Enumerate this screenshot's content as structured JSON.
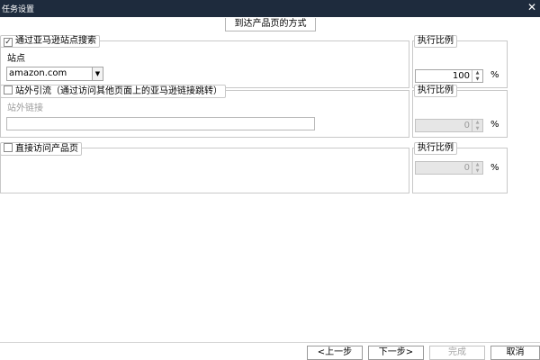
{
  "window": {
    "title": "任务设置"
  },
  "header": {
    "label": "到达产品页的方式"
  },
  "sections": [
    {
      "legend": "通过亚马逊站点搜索",
      "checked": true,
      "site_label": "站点",
      "site_value": "amazon.com",
      "ratio_label": "执行比例",
      "ratio_value": "100",
      "ratio_unit": "%"
    },
    {
      "legend": "站外引流（通过访问其他页面上的亚马逊链接跳转）",
      "checked": false,
      "link_label": "站外链接",
      "link_value": "",
      "ratio_label": "执行比例",
      "ratio_value": "0",
      "ratio_unit": "%"
    },
    {
      "legend": "直接访问产品页",
      "checked": false,
      "ratio_label": "执行比例",
      "ratio_value": "0",
      "ratio_unit": "%"
    }
  ],
  "footer": {
    "prev": "<上一步",
    "next": "下一步>",
    "finish": "完成",
    "cancel": "取消"
  }
}
